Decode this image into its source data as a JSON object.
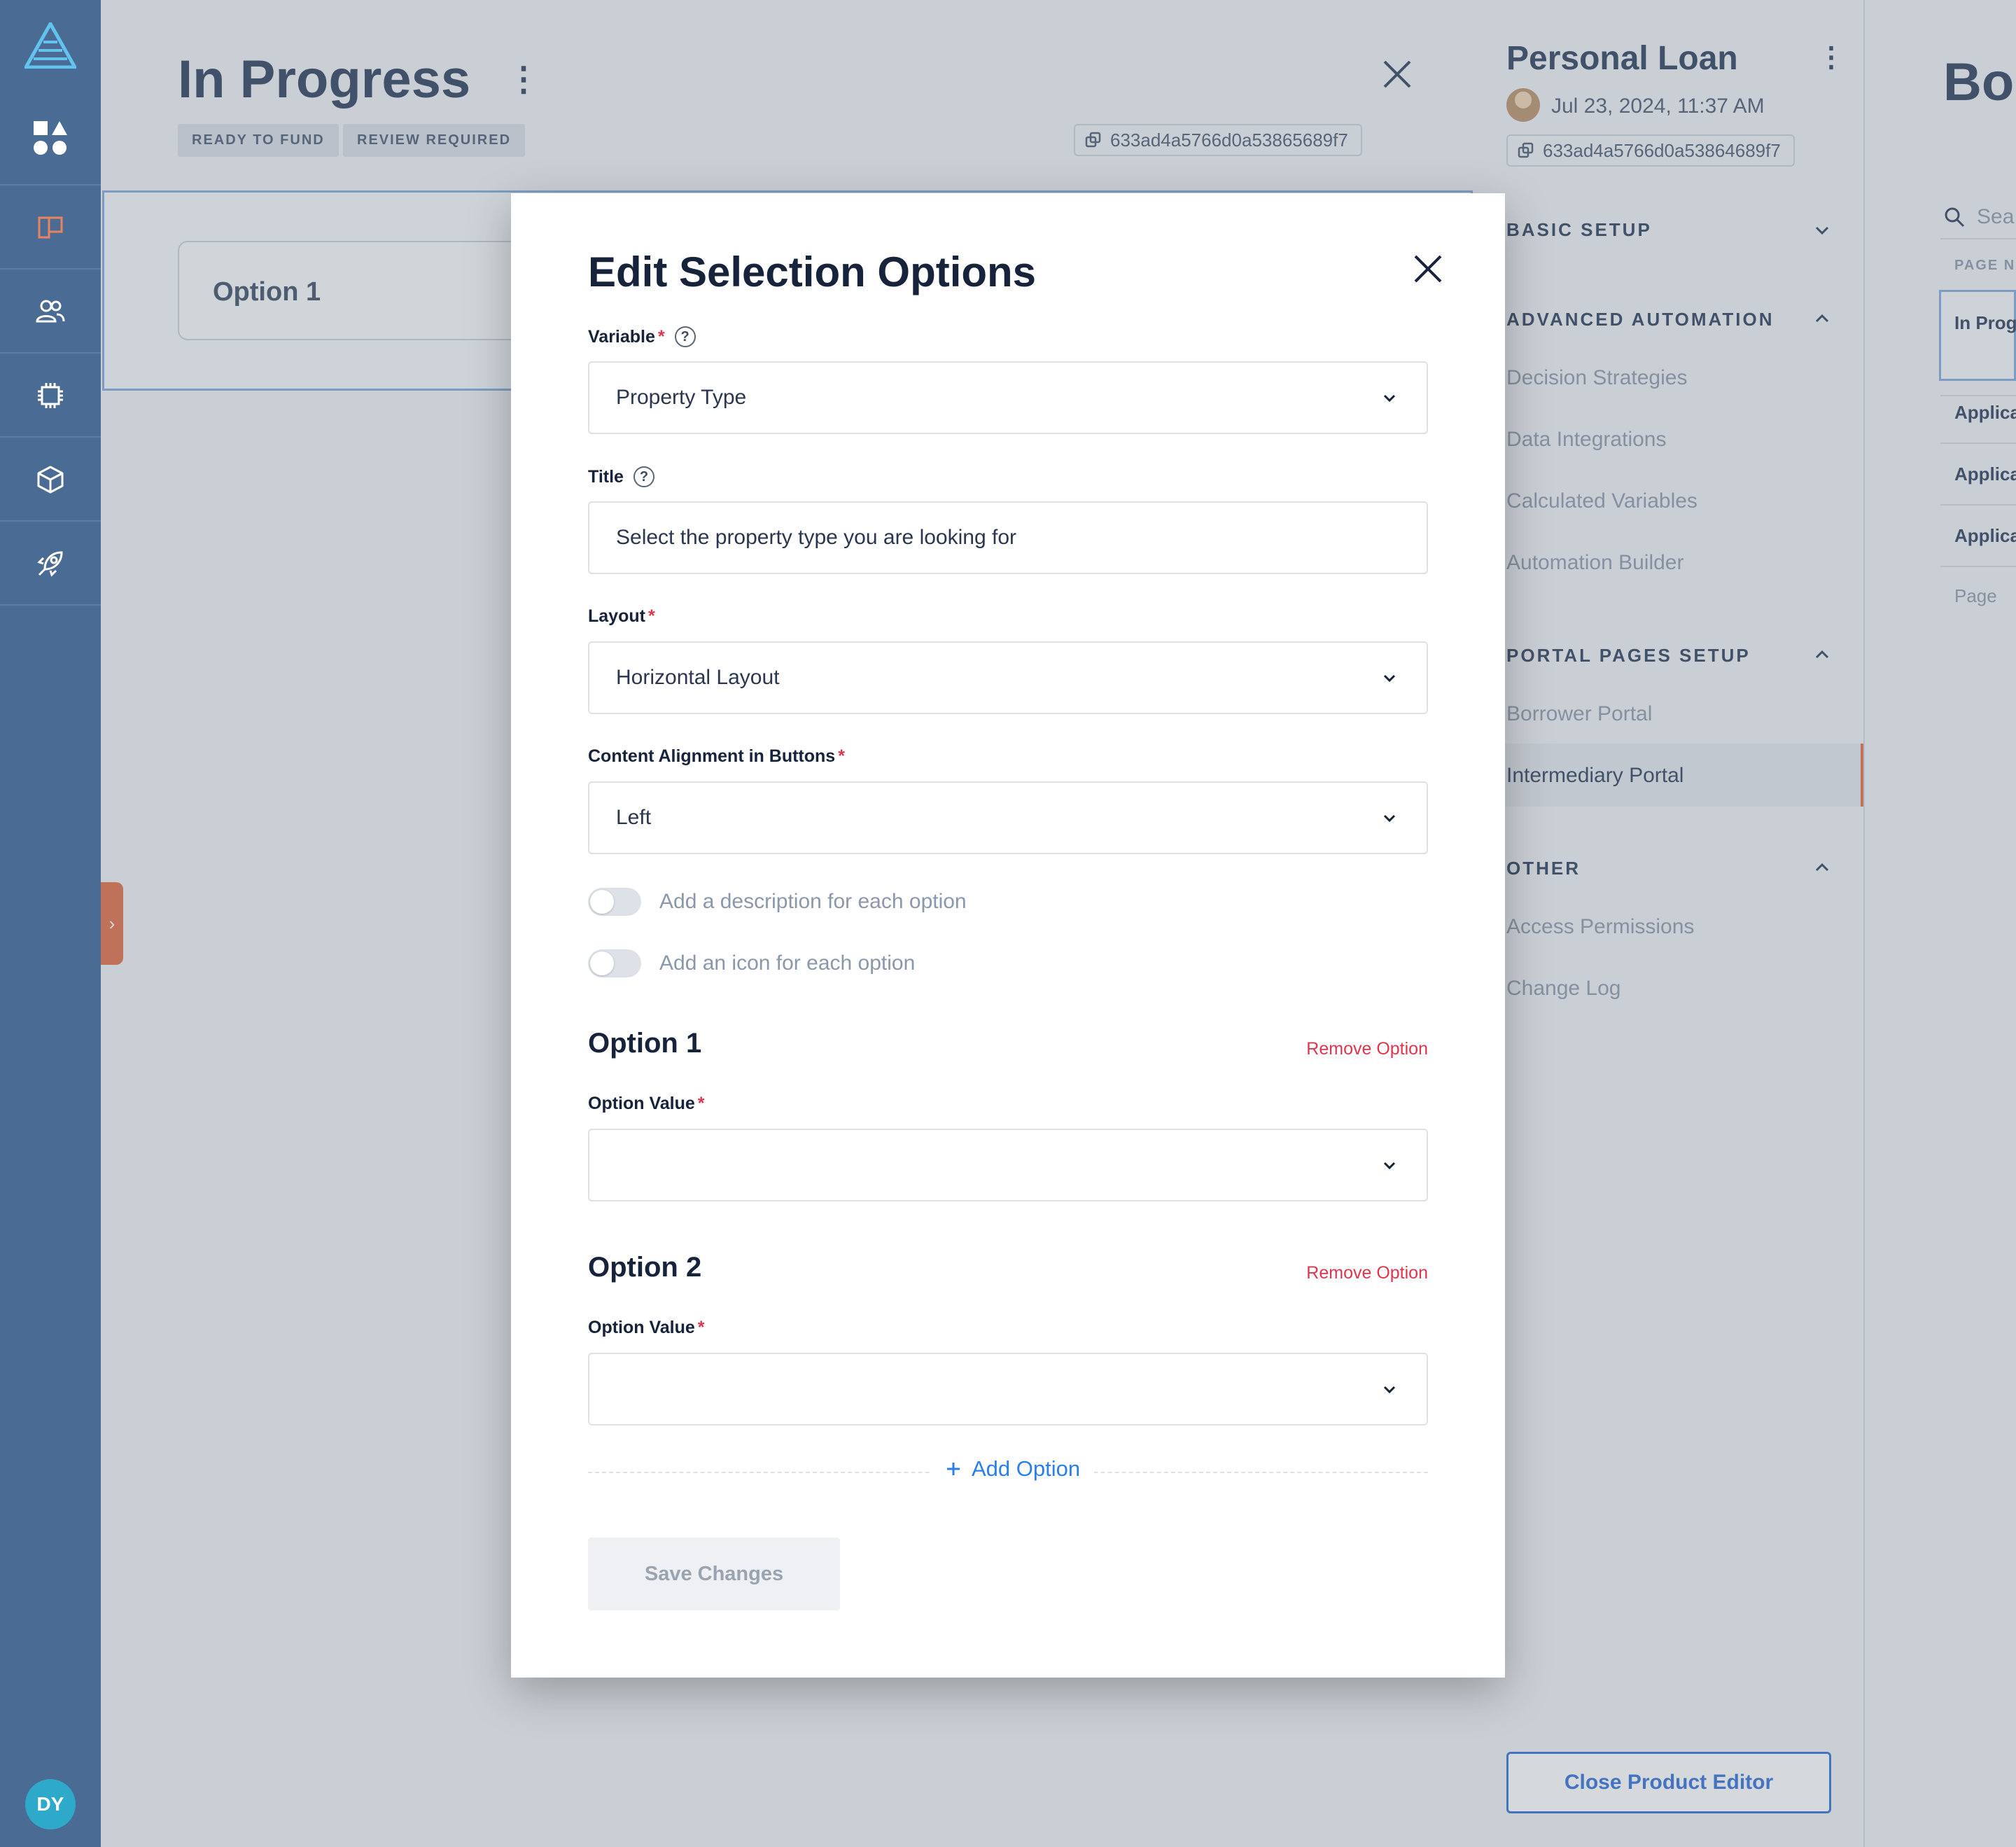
{
  "user": {
    "initials": "DY"
  },
  "page": {
    "title": "In Progress",
    "tags": [
      "READY TO FUND",
      "REVIEW REQUIRED"
    ],
    "id": "633ad4a5766d0a53865689f7",
    "option_card_label": "Option 1"
  },
  "settings_panel": {
    "title": "Personal Loan",
    "date": "Jul 23, 2024, 11:37 AM",
    "id": "633ad4a5766d0a53864689f7",
    "sections": [
      {
        "title": "BASIC SETUP",
        "items": []
      },
      {
        "title": "ADVANCED AUTOMATION",
        "items": [
          "Decision Strategies",
          "Data Integrations",
          "Calculated Variables",
          "Automation Builder"
        ]
      },
      {
        "title": "PORTAL PAGES SETUP",
        "items": [
          "Borrower Portal",
          "Intermediary Portal"
        ]
      },
      {
        "title": "OTHER",
        "items": [
          "Access Permissions",
          "Change Log"
        ]
      }
    ],
    "active_item": "Intermediary Portal",
    "close_button": "Close Product Editor"
  },
  "far_right": {
    "title": "Bo",
    "search_placeholder": "Sea",
    "column_header": "PAGE NA",
    "items": [
      "In Prog",
      "Applica",
      "Applica",
      "Applica"
    ],
    "footer": "Page"
  },
  "modal": {
    "title": "Edit Selection Options",
    "variable_label": "Variable",
    "variable_value": "Property Type",
    "title_label": "Title",
    "title_value": "Select the property type you are looking for",
    "layout_label": "Layout",
    "layout_value": "Horizontal Layout",
    "alignment_label": "Content Alignment in Buttons",
    "alignment_value": "Left",
    "toggle_description": "Add a description for each option",
    "toggle_icon": "Add an icon for each option",
    "options": [
      {
        "heading": "Option 1",
        "remove_label": "Remove Option",
        "value_label": "Option Value",
        "value": ""
      },
      {
        "heading": "Option 2",
        "remove_label": "Remove Option",
        "value_label": "Option Value",
        "value": ""
      }
    ],
    "add_option": "Add Option",
    "save_button": "Save Changes"
  },
  "colors": {
    "rail": "#4a6b94",
    "accent_orange": "#e06a45",
    "primary_blue": "#2f6fd9",
    "required_red": "#e0364d"
  }
}
